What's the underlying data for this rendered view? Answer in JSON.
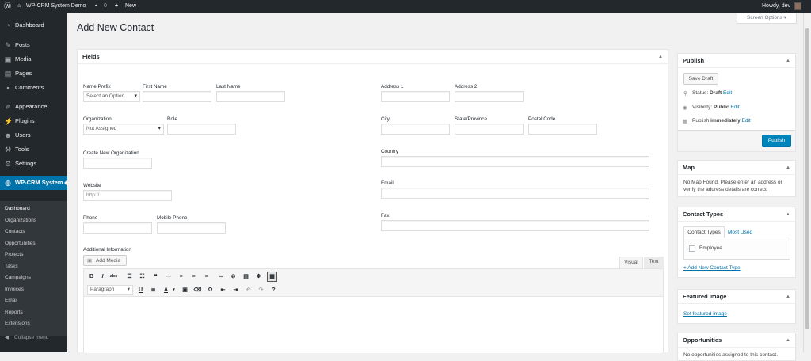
{
  "admin_bar": {
    "site_name": "WP-CRM System Demo",
    "comments_count": "0",
    "new_label": "New",
    "howdy": "Howdy, dev"
  },
  "sidebar": {
    "menu": [
      {
        "label": "Dashboard",
        "icon": "dashboard-icon"
      },
      {
        "label": "Posts",
        "icon": "pin-icon"
      },
      {
        "label": "Media",
        "icon": "media-icon"
      },
      {
        "label": "Pages",
        "icon": "pages-icon"
      },
      {
        "label": "Comments",
        "icon": "comments-icon"
      },
      {
        "label": "Appearance",
        "icon": "brush-icon"
      },
      {
        "label": "Plugins",
        "icon": "plugin-icon"
      },
      {
        "label": "Users",
        "icon": "users-icon"
      },
      {
        "label": "Tools",
        "icon": "wrench-icon"
      },
      {
        "label": "Settings",
        "icon": "settings-icon"
      },
      {
        "label": "WP-CRM System",
        "icon": "globe-icon"
      }
    ],
    "submenu": [
      "Dashboard",
      "Organizations",
      "Contacts",
      "Opportunities",
      "Projects",
      "Tasks",
      "Campaigns",
      "Invoices",
      "Email",
      "Reports",
      "Extensions"
    ],
    "collapse": "Collapse menu"
  },
  "screen_options": "Screen Options",
  "page_title": "Add New Contact",
  "fields_box": {
    "title": "Fields",
    "name_prefix": {
      "label": "Name Prefix",
      "value": "Select an Option"
    },
    "first_name": {
      "label": "First Name",
      "value": ""
    },
    "last_name": {
      "label": "Last Name",
      "value": ""
    },
    "address1": {
      "label": "Address 1",
      "value": ""
    },
    "address2": {
      "label": "Address 2",
      "value": ""
    },
    "organization": {
      "label": "Organization",
      "value": "Not Assigned"
    },
    "role": {
      "label": "Role",
      "value": ""
    },
    "city": {
      "label": "City",
      "value": ""
    },
    "state": {
      "label": "State/Province",
      "value": ""
    },
    "postal": {
      "label": "Postal Code",
      "value": ""
    },
    "create_org": {
      "label": "Create New Organization",
      "value": ""
    },
    "country": {
      "label": "Country",
      "value": ""
    },
    "website": {
      "label": "Website",
      "placeholder": "http://"
    },
    "email": {
      "label": "Email",
      "value": ""
    },
    "phone": {
      "label": "Phone",
      "value": ""
    },
    "mobile": {
      "label": "Mobile Phone",
      "value": ""
    },
    "fax": {
      "label": "Fax",
      "value": ""
    },
    "additional": {
      "label": "Additional Information"
    },
    "add_media": "Add Media",
    "tab_visual": "Visual",
    "tab_text": "Text",
    "paragraph": "Paragraph"
  },
  "publish_box": {
    "title": "Publish",
    "save_draft": "Save Draft",
    "status_label": "Status:",
    "status_value": "Draft",
    "visibility_label": "Visibility:",
    "visibility_value": "Public",
    "publish_label": "Publish",
    "publish_value": "immediately",
    "edit": "Edit",
    "publish_button": "Publish"
  },
  "map_box": {
    "title": "Map",
    "text": "No Map Found. Please enter an address or verify the address details are correct."
  },
  "types_box": {
    "title": "Contact Types",
    "tab_all": "Contact Types",
    "tab_most": "Most Used",
    "item": "Employee",
    "add_link": "+ Add New Contact Type"
  },
  "featured_box": {
    "title": "Featured Image",
    "link": "Set featured image"
  },
  "opps_box": {
    "title": "Opportunities",
    "text": "No opportunities assigned to this contact."
  },
  "colors": {
    "accent": "#0073aa",
    "sidebar": "#23282d",
    "submenu": "#32373c"
  }
}
